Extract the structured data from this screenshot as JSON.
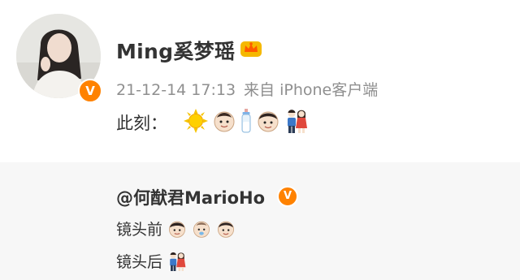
{
  "post": {
    "author_name": "Ming奚梦瑶",
    "verified_badge": "V",
    "timestamp": "21-12-14 17:13",
    "source": "来自 iPhone客户端",
    "text": "此刻：",
    "emojis": [
      "sun-emoji",
      "baby-face-emoji",
      "baby-bottle-emoji",
      "boy-face-emoji",
      "couple-emoji"
    ]
  },
  "repost": {
    "author": "@何猷君MarioHo",
    "verified_badge": "V",
    "line1_text": "镜头前",
    "line1_emojis": [
      "man-face-emoji",
      "baby-face-emoji",
      "boy-face-emoji"
    ],
    "line2_text": "镜头后",
    "line2_emojis": [
      "couple-emoji"
    ]
  },
  "colors": {
    "badge": "#ff8200",
    "crown": "#f5b800",
    "meta_text": "#8f8f8f",
    "repost_bg": "#f7f7f7"
  }
}
